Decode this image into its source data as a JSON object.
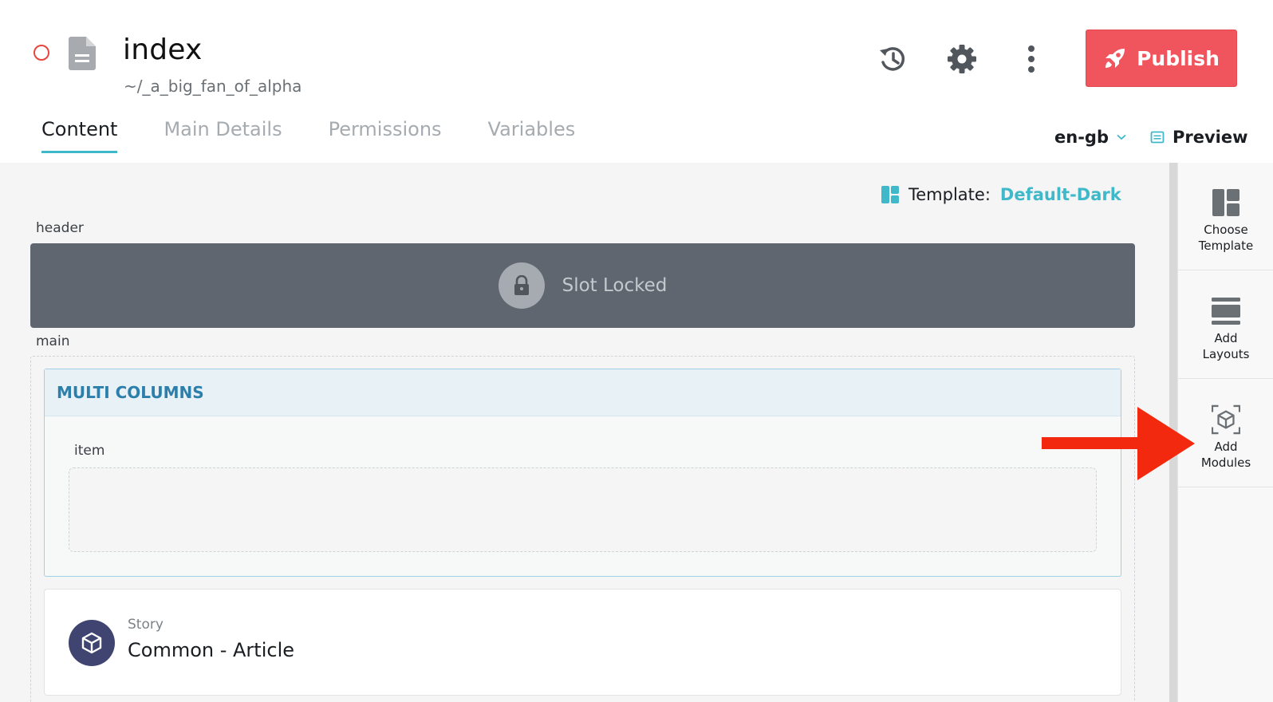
{
  "document": {
    "title": "index",
    "path": "~/_a_big_fan_of_alpha",
    "status_color": "#e8463f"
  },
  "toolbar": {
    "history_icon": "history-icon",
    "settings_icon": "gear-icon",
    "more_icon": "kebab-icon",
    "publish_label": "Publish",
    "publish_color": "#f0545c"
  },
  "tabs": [
    {
      "label": "Content",
      "active": true
    },
    {
      "label": "Main Details",
      "active": false
    },
    {
      "label": "Permissions",
      "active": false
    },
    {
      "label": "Variables",
      "active": false
    }
  ],
  "locale": {
    "value": "en-gb"
  },
  "preview": {
    "label": "Preview"
  },
  "template": {
    "prefix": "Template:",
    "name": "Default-Dark"
  },
  "slots": {
    "header": {
      "label": "header",
      "locked_text": "Slot Locked"
    },
    "main": {
      "label": "main"
    }
  },
  "multi_columns": {
    "title": "MULTI COLUMNS",
    "item_label": "item"
  },
  "story": {
    "type": "Story",
    "name": "Common - Article"
  },
  "right_panel": {
    "items": [
      {
        "icon": "template-icon",
        "label_line1": "Choose",
        "label_line2": "Template"
      },
      {
        "icon": "layouts-icon",
        "label_line1": "Add",
        "label_line2": "Layouts"
      },
      {
        "icon": "modules-icon",
        "label_line1": "Add",
        "label_line2": "Modules"
      }
    ]
  },
  "colors": {
    "accent": "#3fb8c9",
    "annotation_arrow": "#f2290e"
  }
}
